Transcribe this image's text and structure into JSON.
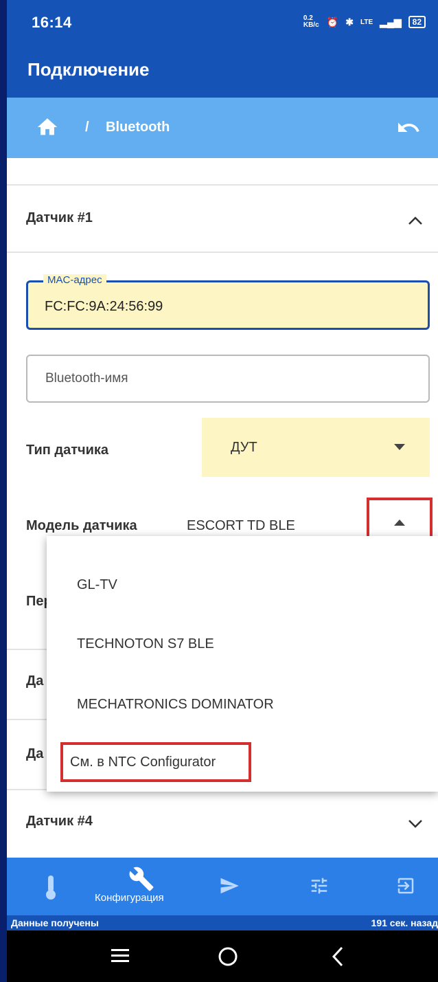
{
  "status_bar": {
    "time": "16:14",
    "net_speed": "0.2 KB/c",
    "net_type": "LTE",
    "battery": "82"
  },
  "app_bar": {
    "title": "Подключение"
  },
  "breadcrumb": {
    "separator": "/",
    "current": "Bluetooth"
  },
  "sensor1": {
    "header": "Датчик #1",
    "mac_label": "MAC-адрес",
    "mac_value": "FC:FC:9A:24:56:99",
    "name_placeholder": "Bluetooth-имя",
    "type_label": "Тип датчика",
    "type_value": "ДУТ",
    "model_label": "Модель датчика",
    "model_value": "ESCORT TD BLE",
    "next_row_peek": "Пер"
  },
  "model_dropdown": {
    "options": [
      "GL-TV",
      "TECHNOTON S7 BLE",
      "MECHATRONICS DOMINATOR",
      "См. в NTC Configurator"
    ]
  },
  "collapsed_sections": {
    "sensor2_peek": "Да",
    "sensor3_peek": "Да",
    "sensor4": "Датчик #4"
  },
  "bottom_nav": {
    "active_label": "Конфигурация"
  },
  "status_line": {
    "left": "Данные получены",
    "right": "191 сек. назад"
  },
  "colors": {
    "primary": "#1653b7",
    "breadcrumb": "#62aef0",
    "highlight_field": "#fdf6c4",
    "nav": "#2c7fe6",
    "annotation": "#d32f2f"
  }
}
